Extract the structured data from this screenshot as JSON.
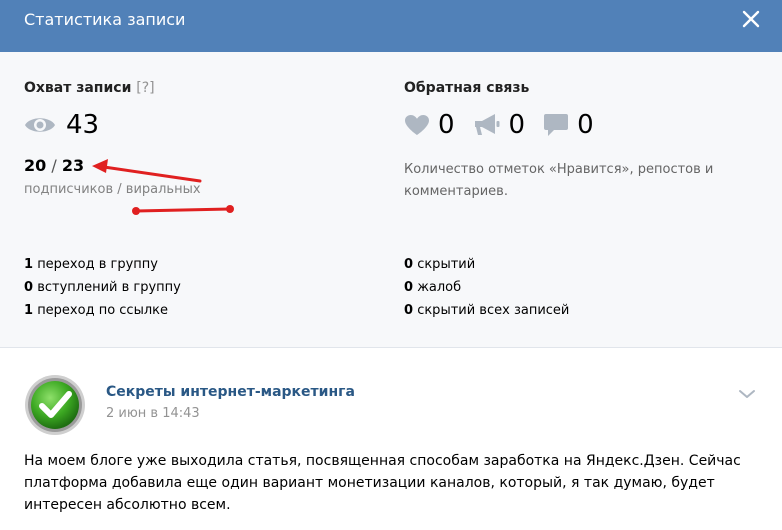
{
  "header": {
    "title": "Статистика записи"
  },
  "reach": {
    "title": "Охват записи",
    "help": "[?]",
    "views": "43",
    "subscribers": "20",
    "viral": "23",
    "caption": "подписчиков / виральных"
  },
  "feedback": {
    "title": "Обратная связь",
    "likes": "0",
    "reposts": "0",
    "comments": "0",
    "caption": "Количество отметок «Нравится», репостов и комментариев."
  },
  "actions": [
    {
      "count": "1",
      "label": "переход в группу"
    },
    {
      "count": "0",
      "label": "вступлений в группу"
    },
    {
      "count": "1",
      "label": "переход по ссылке"
    }
  ],
  "negative": [
    {
      "count": "0",
      "label": "скрытий"
    },
    {
      "count": "0",
      "label": "жалоб"
    },
    {
      "count": "0",
      "label": "скрытий всех записей"
    }
  ],
  "post": {
    "author": "Секреты интернет-маркетинга",
    "date": "2 июн в 14:43",
    "text": "На моем блоге уже выходила статья, посвященная способам заработка на Яндекс.Дзен. Сейчас платформа добавила еще один вариант монетизации каналов, который, я так думаю, будет интересен абсолютно всем."
  },
  "colors": {
    "header": "#5181b8",
    "link": "#2a5885",
    "annotation": "#e02020"
  }
}
